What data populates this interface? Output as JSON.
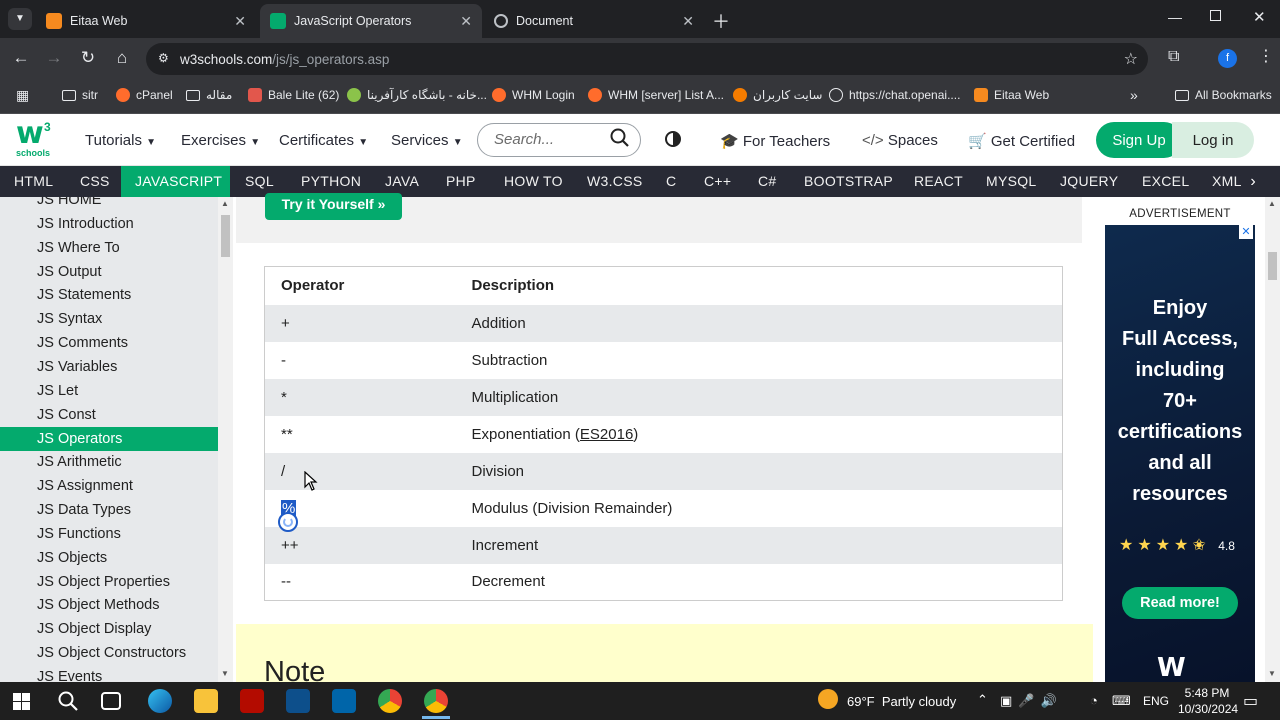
{
  "tabs": [
    {
      "title": "Eitaa Web",
      "active": false
    },
    {
      "title": "JavaScript Operators",
      "active": true
    },
    {
      "title": "Document",
      "active": false
    }
  ],
  "address": {
    "domain": "w3schools.com",
    "path": "/js/js_operators.asp"
  },
  "bookmarks": [
    {
      "label": "sitr",
      "icon": "folder-icon"
    },
    {
      "label": "cPanel",
      "icon": "cpanel-icon"
    },
    {
      "label": "مقاله",
      "icon": "folder-icon"
    },
    {
      "label": "Bale Lite (62)",
      "icon": "bale-icon"
    },
    {
      "label": "خانه - باشگاه کارآفرینا...",
      "icon": "site-icon"
    },
    {
      "label": "WHM Login",
      "icon": "cpanel-icon"
    },
    {
      "label": "WHM [server] List A...",
      "icon": "cpanel-icon"
    },
    {
      "label": "سایت کاربران",
      "icon": "site-icon"
    },
    {
      "label": "https://chat.openai....",
      "icon": "openai-icon"
    },
    {
      "label": "Eitaa Web",
      "icon": "eitaa-icon"
    }
  ],
  "all_bookmarks": "All Bookmarks",
  "w3": {
    "logo_w": "w",
    "logo_3": "3",
    "logo_sub": "schools",
    "menu": [
      "Tutorials",
      "Exercises",
      "Certificates",
      "Services"
    ],
    "search_placeholder": "Search...",
    "for_teachers": "For Teachers",
    "spaces": "Spaces",
    "get_certified": "Get Certified",
    "signup": "Sign Up",
    "login": "Log in"
  },
  "topnav": [
    "HTML",
    "CSS",
    "JAVASCRIPT",
    "SQL",
    "PYTHON",
    "JAVA",
    "PHP",
    "HOW TO",
    "W3.CSS",
    "C",
    "C++",
    "C#",
    "BOOTSTRAP",
    "REACT",
    "MYSQL",
    "JQUERY",
    "EXCEL",
    "XML"
  ],
  "topnav_active": "JAVASCRIPT",
  "sidebar": [
    "JS HOME",
    "JS Introduction",
    "JS Where To",
    "JS Output",
    "JS Statements",
    "JS Syntax",
    "JS Comments",
    "JS Variables",
    "JS Let",
    "JS Const",
    "JS Operators",
    "JS Arithmetic",
    "JS Assignment",
    "JS Data Types",
    "JS Functions",
    "JS Objects",
    "JS Object Properties",
    "JS Object Methods",
    "JS Object Display",
    "JS Object Constructors",
    "JS Events"
  ],
  "sidebar_active": "JS Operators",
  "try_button": "Try it Yourself »",
  "table": {
    "headers": [
      "Operator",
      "Description"
    ],
    "rows": [
      {
        "op": "+",
        "desc": "Addition"
      },
      {
        "op": "-",
        "desc": "Subtraction"
      },
      {
        "op": "*",
        "desc": "Multiplication"
      },
      {
        "op": "**",
        "desc": "Exponentiation (",
        "link": "ES2016",
        "after": ")"
      },
      {
        "op": "/",
        "desc": "Division"
      },
      {
        "op": "%",
        "desc": "Modulus (Division Remainder)"
      },
      {
        "op": "++",
        "desc": "Increment"
      },
      {
        "op": "--",
        "desc": "Decrement"
      }
    ]
  },
  "note_title": "Note",
  "ad": {
    "label": "ADVERTISEMENT",
    "lines": [
      "Enjoy",
      "Full Access,",
      "including",
      "70+",
      "certifications",
      "and all",
      "resources"
    ],
    "rating": "4.8",
    "button": "Read more!"
  },
  "taskbar": {
    "weather": "69°F  Partly cloudy",
    "lang": "ENG",
    "time": "5:48 PM",
    "date": "10/30/2024"
  },
  "colors": {
    "w3_green": "#04aa6d",
    "topnav_bg": "#282a35",
    "sidebar_bg": "#e7e9eb",
    "chrome_bg": "#35363a"
  }
}
